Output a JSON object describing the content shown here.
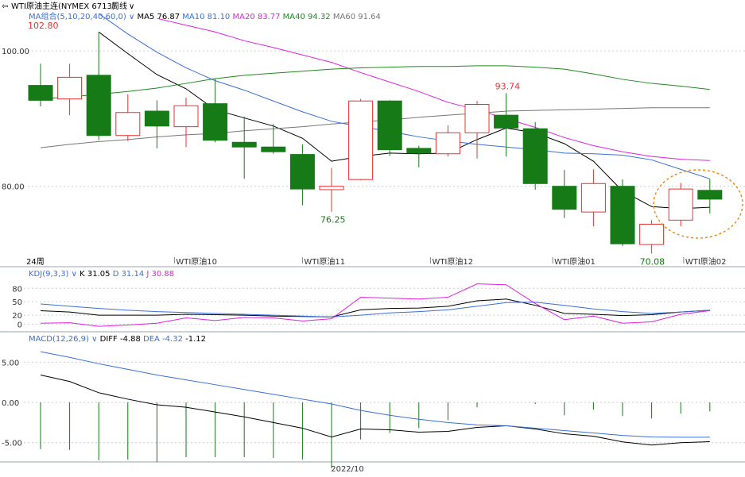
{
  "header": {
    "title": "WTI原油主连(NYMEX 6713)",
    "period": "周线",
    "period_icon": "chevron-down-icon",
    "pin_icon": "pin-icon"
  },
  "main_panel": {
    "ma_label": "MA组合(5,10,20,40,60,0)",
    "ma_values": [
      {
        "name": "MA5",
        "value": "76.87",
        "color": "#000000"
      },
      {
        "name": "MA10",
        "value": "81.10",
        "color": "#3a6fd8"
      },
      {
        "name": "MA20",
        "value": "83.77",
        "color": "#e020e0"
      },
      {
        "name": "MA40",
        "value": "94.32",
        "color": "#1f8a1f"
      },
      {
        "name": "MA60",
        "value": "91.64",
        "color": "#777777"
      }
    ],
    "period_label": "24周",
    "y_ticks": [
      "100.00",
      "80.00"
    ],
    "x_labels": [
      "WTI原油10",
      "WTI原油11",
      "WTI原油12",
      "WTI原油01",
      "WTI原油02"
    ],
    "annotations": {
      "high_label": "102.80",
      "local_high_label": "93.74",
      "low1_label": "76.25",
      "low2_label": "70.08"
    }
  },
  "kdj_panel": {
    "label": "KDJ(9,3,3)",
    "values": [
      {
        "name": "K",
        "value": "31.05",
        "color": "#000000"
      },
      {
        "name": "D",
        "value": "31.14",
        "color": "#3a6fd8"
      },
      {
        "name": "J",
        "value": "30.88",
        "color": "#e020e0"
      }
    ],
    "y_ticks": [
      "80",
      "50",
      "20",
      "0"
    ]
  },
  "macd_panel": {
    "label": "MACD(12,26,9)",
    "values": [
      {
        "name": "DIFF",
        "value": "-4.88",
        "color": "#000000"
      },
      {
        "name": "DEA",
        "value": "-4.32",
        "color": "#3a6fd8"
      },
      {
        "name": "",
        "value": "-1.12",
        "color": "#000000"
      }
    ],
    "y_ticks": [
      "5.00",
      "0.00",
      "-5.00"
    ]
  },
  "footer": {
    "date_label": "2022/10"
  },
  "colors": {
    "up": "#e83030",
    "down": "#167a16",
    "grid": "#c9ced6",
    "highlight": "#f08a1c"
  },
  "chart_data": {
    "type": "candlestick",
    "title": "WTI原油主连(NYMEX 6713)",
    "ylim": [
      70,
      104
    ],
    "candles": [
      {
        "o": 94.9,
        "h": 98.1,
        "l": 91.8,
        "c": 92.7
      },
      {
        "o": 92.9,
        "h": 98.1,
        "l": 90.5,
        "c": 96.1
      },
      {
        "o": 96.4,
        "h": 102.8,
        "l": 86.8,
        "c": 87.5
      },
      {
        "o": 87.5,
        "h": 93.6,
        "l": 86.7,
        "c": 90.9
      },
      {
        "o": 91.1,
        "h": 92.7,
        "l": 85.6,
        "c": 88.9
      },
      {
        "o": 88.8,
        "h": 93.1,
        "l": 85.8,
        "c": 91.9
      },
      {
        "o": 92.2,
        "h": 95.9,
        "l": 86.5,
        "c": 86.8
      },
      {
        "o": 86.5,
        "h": 90.3,
        "l": 81.1,
        "c": 85.8
      },
      {
        "o": 85.8,
        "h": 89.2,
        "l": 84.8,
        "c": 85.1
      },
      {
        "o": 84.7,
        "h": 86.2,
        "l": 77.2,
        "c": 79.6
      },
      {
        "o": 79.5,
        "h": 82.7,
        "l": 76.25,
        "c": 80.0
      },
      {
        "o": 81.0,
        "h": 92.9,
        "l": 80.9,
        "c": 92.6
      },
      {
        "o": 92.6,
        "h": 92.7,
        "l": 84.5,
        "c": 85.4
      },
      {
        "o": 85.6,
        "h": 86.0,
        "l": 82.8,
        "c": 84.9
      },
      {
        "o": 84.8,
        "h": 89.0,
        "l": 84.4,
        "c": 87.9
      },
      {
        "o": 87.9,
        "h": 92.6,
        "l": 84.1,
        "c": 92.1
      },
      {
        "o": 90.5,
        "h": 93.74,
        "l": 84.4,
        "c": 88.6
      },
      {
        "o": 88.5,
        "h": 89.5,
        "l": 79.5,
        "c": 80.4
      },
      {
        "o": 80.0,
        "h": 82.4,
        "l": 75.3,
        "c": 76.6
      },
      {
        "o": 76.2,
        "h": 82.5,
        "l": 74.1,
        "c": 80.4
      },
      {
        "o": 80.0,
        "h": 81.0,
        "l": 71.2,
        "c": 71.5
      },
      {
        "o": 71.4,
        "h": 75.0,
        "l": 70.08,
        "c": 74.4
      },
      {
        "o": 75.0,
        "h": 80.5,
        "l": 74.1,
        "c": 79.6
      },
      {
        "o": 79.4,
        "h": 81.1,
        "l": 76.0,
        "c": 78.1
      }
    ],
    "ma": [
      {
        "name": "MA5",
        "color": "#000000",
        "values": [
          null,
          null,
          102.8,
          99.6,
          96.5,
          94.4,
          91.3,
          90.1,
          88.9,
          87.1,
          83.7,
          84.4,
          84.9,
          84.8,
          84.9,
          86.9,
          88.6,
          87.9,
          86.3,
          83.7,
          79.3,
          77.0,
          76.7,
          76.9
        ]
      },
      {
        "name": "MA10",
        "color": "#3a6fd8",
        "values": [
          null,
          null,
          105.5,
          102.5,
          99.8,
          97.5,
          95.6,
          94.2,
          92.6,
          91.0,
          89.6,
          88.8,
          88.1,
          87.3,
          86.7,
          86.2,
          85.8,
          85.4,
          84.9,
          84.8,
          84.6,
          83.9,
          82.5,
          81.1
        ]
      },
      {
        "name": "MA20",
        "color": "#e020e0",
        "values": [
          null,
          null,
          null,
          null,
          104.8,
          103.8,
          102.8,
          101.5,
          100.5,
          99.4,
          98.3,
          96.8,
          95.4,
          94.0,
          92.4,
          91.3,
          90.0,
          88.7,
          87.2,
          86.0,
          85.1,
          84.4,
          84.0,
          83.8
        ]
      },
      {
        "name": "MA40",
        "color": "#1f8a1f",
        "values": [
          92.9,
          93.2,
          93.6,
          94.0,
          94.5,
          95.2,
          95.9,
          96.4,
          96.7,
          97.0,
          97.3,
          97.5,
          97.6,
          97.7,
          97.7,
          97.8,
          97.8,
          97.6,
          97.3,
          96.6,
          95.8,
          95.2,
          94.8,
          94.3
        ]
      },
      {
        "name": "MA60",
        "color": "#777777",
        "values": [
          85.7,
          86.2,
          86.6,
          86.9,
          87.3,
          87.6,
          87.8,
          88.2,
          88.5,
          88.8,
          89.2,
          89.5,
          89.8,
          90.2,
          90.5,
          90.8,
          91.1,
          91.2,
          91.3,
          91.4,
          91.5,
          91.6,
          91.6,
          91.6
        ]
      }
    ],
    "kdj": {
      "ylim": [
        -10,
        100
      ],
      "K": [
        30,
        27,
        20,
        20,
        20,
        22,
        21,
        20,
        18,
        17,
        16,
        32,
        35,
        36,
        40,
        52,
        56,
        42,
        24,
        22,
        19,
        21,
        27,
        31
      ],
      "D": [
        45,
        40,
        35,
        31,
        28,
        26,
        24,
        22,
        20,
        18,
        16,
        20,
        25,
        28,
        32,
        40,
        48,
        49,
        42,
        34,
        28,
        24,
        27,
        31
      ],
      "J": [
        2,
        3,
        -5,
        -2,
        2,
        14,
        8,
        15,
        14,
        7,
        12,
        60,
        58,
        56,
        60,
        90,
        88,
        46,
        10,
        18,
        2,
        5,
        22,
        30
      ]
    },
    "macd": {
      "ylim": [
        -7,
        7
      ],
      "DIFF": [
        3.4,
        2.6,
        1.2,
        0.4,
        -0.3,
        -0.6,
        -1.2,
        -1.8,
        -2.5,
        -3.2,
        -4.3,
        -3.3,
        -3.4,
        -3.7,
        -3.6,
        -3.1,
        -2.9,
        -3.3,
        -3.9,
        -4.2,
        -4.9,
        -5.3,
        -5.0,
        -4.88
      ],
      "DEA": [
        6.3,
        5.6,
        4.8,
        4.1,
        3.4,
        2.8,
        2.2,
        1.6,
        1.0,
        0.4,
        -0.2,
        -1.0,
        -1.6,
        -2.1,
        -2.5,
        -2.8,
        -2.9,
        -3.2,
        -3.5,
        -3.8,
        -4.1,
        -4.3,
        -4.32,
        -4.32
      ],
      "bar": [
        -5.8,
        -5.9,
        -7.2,
        -7.1,
        -7.4,
        -6.8,
        -6.8,
        -6.8,
        -6.9,
        -7.1,
        -8.2,
        -4.6,
        -3.8,
        -3.2,
        -2.2,
        -0.6,
        0,
        -0.2,
        -1.6,
        -0.9,
        -1.7,
        -2.0,
        -1.4,
        -1.12
      ]
    }
  }
}
